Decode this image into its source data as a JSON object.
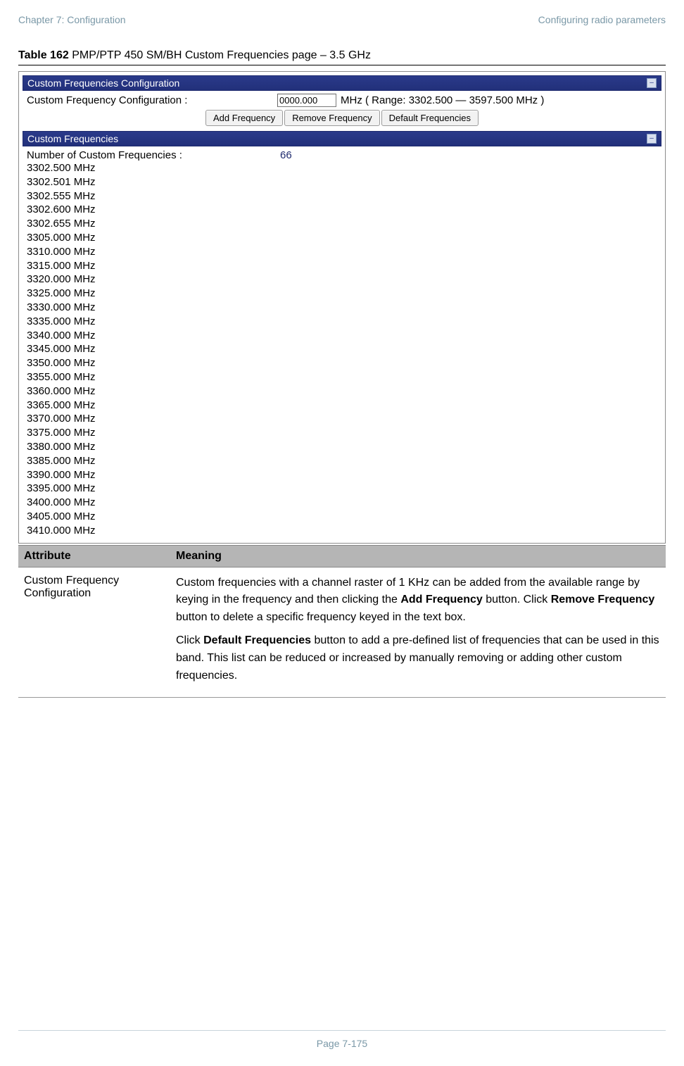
{
  "header": {
    "left": "Chapter 7:  Configuration",
    "right": "Configuring radio parameters"
  },
  "caption": {
    "prefix_bold": "Table 162",
    "rest": " PMP/PTP 450 SM/BH Custom Frequencies page – 3.5 GHz"
  },
  "ui": {
    "config_section_title": "Custom Frequencies Configuration",
    "config_label": "Custom Frequency Configuration :",
    "config_input_value": "0000.000",
    "config_unit_text": "MHz ( Range: 3302.500 — 3597.500 MHz )",
    "buttons": {
      "add": "Add Frequency",
      "remove": "Remove Frequency",
      "defaults": "Default Frequencies"
    },
    "collapse_glyph": "–",
    "list_section_title": "Custom Frequencies",
    "count_label": "Number of Custom Frequencies :",
    "count_value": "66",
    "frequencies": [
      "3302.500 MHz",
      "3302.501 MHz",
      "3302.555 MHz",
      "3302.600 MHz",
      "3302.655 MHz",
      "3305.000 MHz",
      "3310.000 MHz",
      "3315.000 MHz",
      "3320.000 MHz",
      "3325.000 MHz",
      "3330.000 MHz",
      "3335.000 MHz",
      "3340.000 MHz",
      "3345.000 MHz",
      "3350.000 MHz",
      "3355.000 MHz",
      "3360.000 MHz",
      "3365.000 MHz",
      "3370.000 MHz",
      "3375.000 MHz",
      "3380.000 MHz",
      "3385.000 MHz",
      "3390.000 MHz",
      "3395.000 MHz",
      "3400.000 MHz",
      "3405.000 MHz",
      "3410.000 MHz"
    ]
  },
  "table": {
    "col1_header": "Attribute",
    "col2_header": "Meaning",
    "row1_attr": "Custom Frequency Configuration",
    "row1_meaning_p1_a": "Custom frequencies with a channel raster of 1 KHz can be added from the available range by keying in the frequency and then clicking the ",
    "row1_meaning_p1_b": "Add Frequency",
    "row1_meaning_p1_c": " button. Click ",
    "row1_meaning_p1_d": "Remove Frequency",
    "row1_meaning_p1_e": " button to delete a specific frequency keyed in the text box.",
    "row1_meaning_p2_a": "Click ",
    "row1_meaning_p2_b": "Default Frequencies",
    "row1_meaning_p2_c": " button to add a pre-defined list of frequencies that can be used in this band. This list can be reduced or increased by manually removing or adding other custom frequencies."
  },
  "footer": {
    "page": "Page 7-175"
  }
}
